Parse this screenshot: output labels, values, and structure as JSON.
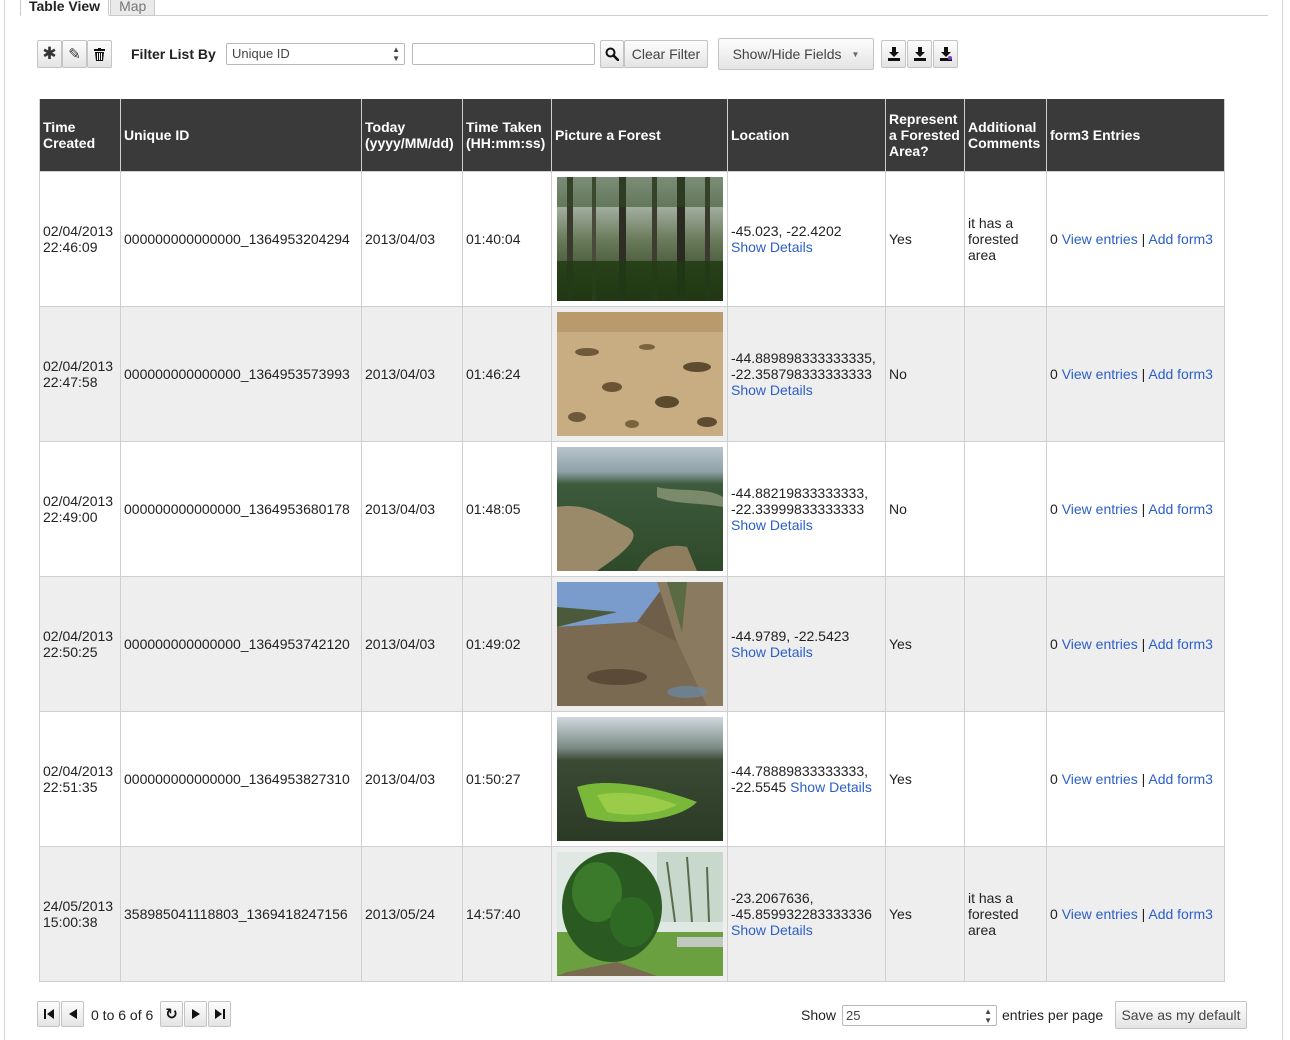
{
  "tabs": [
    {
      "label": "Table View",
      "active": true
    },
    {
      "label": "Map",
      "active": false
    }
  ],
  "toolbar": {
    "add_icon": "asterisk-icon",
    "edit_icon": "pencil-icon",
    "delete_icon": "trash-icon",
    "filter_label": "Filter List By",
    "filter_field_value": "Unique ID",
    "filter_value": "",
    "search_icon": "magnifier-icon",
    "clear_filter_label": "Clear Filter",
    "show_hide_label": "Show/Hide Fields",
    "download_icons": [
      "download-icon",
      "download-icon",
      "download-icon"
    ]
  },
  "table": {
    "columns": [
      {
        "label": "Time Created"
      },
      {
        "label": "Unique ID"
      },
      {
        "label": "Today (yyyy/MM/dd)"
      },
      {
        "label": "Time Taken (HH:mm:ss)"
      },
      {
        "label": "Picture a Forest"
      },
      {
        "label": "Location"
      },
      {
        "label": "Represent a Forested Area?"
      },
      {
        "label": "Additional Comments"
      },
      {
        "label": "form3 Entries"
      }
    ],
    "rows": [
      {
        "time_created": "02/04/2013 22:46:09",
        "unique_id": "000000000000000_1364953204294",
        "today": "2013/04/03",
        "time_taken": "01:40:04",
        "picture": "forest-trees",
        "location": "-45.023, -22.4202",
        "forested": "Yes",
        "comments": "it has a forested area",
        "entries_count": "0"
      },
      {
        "time_created": "02/04/2013 22:47:58",
        "unique_id": "000000000000000_1364953573993",
        "today": "2013/04/03",
        "time_taken": "01:46:24",
        "picture": "dry-field",
        "location": "-44.889898333333335, -22.358798333333333",
        "forested": "No",
        "comments": "",
        "entries_count": "0"
      },
      {
        "time_created": "02/04/2013 22:49:00",
        "unique_id": "000000000000000_1364953680178",
        "today": "2013/04/03",
        "time_taken": "01:48:05",
        "picture": "aerial-valley",
        "location": "-44.88219833333333, -22.33999833333333",
        "forested": "No",
        "comments": "",
        "entries_count": "0"
      },
      {
        "time_created": "02/04/2013 22:50:25",
        "unique_id": "000000000000000_1364953742120",
        "today": "2013/04/03",
        "time_taken": "01:49:02",
        "picture": "dirt-road",
        "location": "-44.9789, -22.5423",
        "forested": "Yes",
        "comments": "",
        "entries_count": "0"
      },
      {
        "time_created": "02/04/2013 22:51:35",
        "unique_id": "000000000000000_1364953827310",
        "today": "2013/04/03",
        "time_taken": "01:50:27",
        "picture": "green-hills",
        "location": "-44.78889833333333, -22.5545",
        "forested": "Yes",
        "comments": "",
        "entries_count": "0"
      },
      {
        "time_created": "24/05/2013 15:00:38",
        "unique_id": "358985041118803_1369418247156",
        "today": "2013/05/24",
        "time_taken": "14:57:40",
        "picture": "garden-plant",
        "location": "-23.2067636, -45.859932283333336",
        "forested": "Yes",
        "comments": "it has a forested area",
        "entries_count": "0"
      }
    ],
    "show_details_label": "Show Details",
    "view_entries_label": "View entries",
    "separator": "|",
    "add_form_label": "Add form3"
  },
  "pager": {
    "first_icon": "first-page-icon",
    "prev_icon": "prev-page-icon",
    "range_text": "0 to 6 of 6",
    "refresh_icon": "refresh-icon",
    "next_icon": "next-page-icon",
    "last_icon": "last-page-icon",
    "show_label": "Show",
    "per_page_value": "25",
    "per_page_label": "entries per page",
    "save_default_label": "Save as my default"
  }
}
